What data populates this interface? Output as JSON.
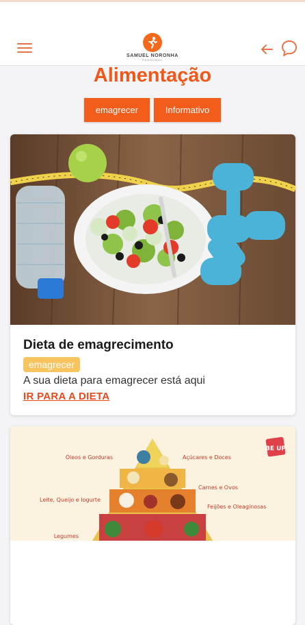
{
  "header": {
    "logo_text": "SAMUEL NORONHA",
    "logo_sub": "PERSONAL",
    "menu_icon": "hamburger-menu-icon",
    "back_icon": "arrow-left-icon",
    "chat_icon": "chat-bubble-icon"
  },
  "page": {
    "title": "Alimentação"
  },
  "tabs": [
    {
      "label": "emagrecer"
    },
    {
      "label": "Informativo"
    }
  ],
  "cards": [
    {
      "title": "Dieta de emagrecimento",
      "badge": "emagrecer",
      "description": "A sua dieta para emagrecer está aqui",
      "link": "IR PARA A DIETA"
    },
    {
      "pyramid_labels": {
        "oils": "Óleos e Gorduras",
        "sugars": "Açúcares e Doces",
        "meats": "Carnes e Ovos",
        "dairy": "Leite, Queijo e Iogurte",
        "beans": "Feijões e Oleaginosas",
        "veg": "Legumes",
        "brand": "BE UP"
      }
    }
  ],
  "colors": {
    "accent": "#f25d1c",
    "badge": "#f7c460",
    "link": "#e8471a"
  }
}
